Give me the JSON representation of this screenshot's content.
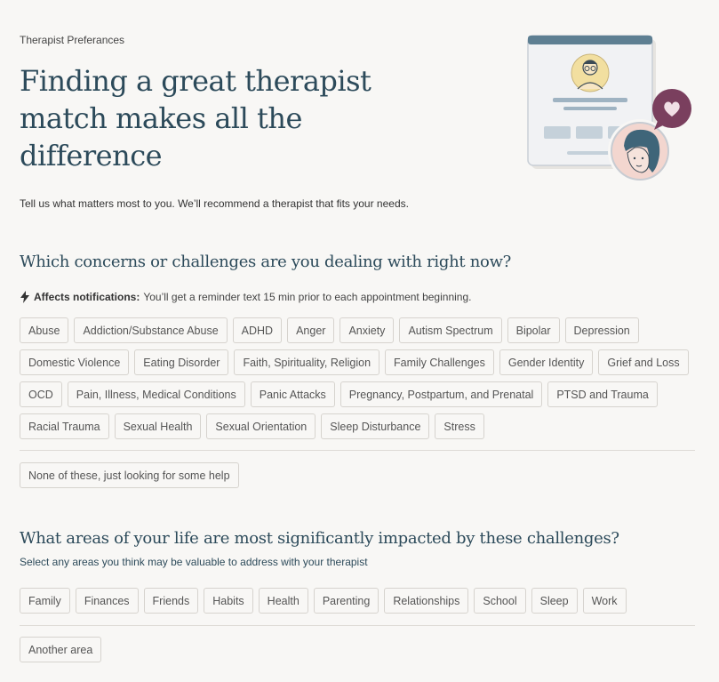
{
  "header": {
    "eyebrow": "Therapist Preferances",
    "title": "Finding a great therapist match makes all the difference",
    "intro": "Tell us what matters most to you. We’ll recommend a therapist that fits your needs."
  },
  "concerns": {
    "title": "Which concerns or challenges are you dealing with right now?",
    "note_label": "Affects notifications:",
    "note_text": "You’ll get a reminder text 15 min prior to each appointment beginning.",
    "options": [
      "Abuse",
      "Addiction/Substance Abuse",
      "ADHD",
      "Anger",
      "Anxiety",
      "Autism Spectrum",
      "Bipolar",
      "Depression",
      "Domestic Violence",
      "Eating Disorder",
      "Faith, Spirituality, Religion",
      "Family Challenges",
      "Gender Identity",
      "Grief and Loss",
      "OCD",
      "Pain, Illness, Medical Conditions",
      "Panic Attacks",
      "Pregnancy, Postpartum, and Prenatal",
      "PTSD and Trauma",
      "Racial Trauma",
      "Sexual Health",
      "Sexual Orientation",
      "Sleep Disturbance",
      "Stress"
    ],
    "none_option": "None of these, just looking for some help"
  },
  "areas": {
    "title": "What areas of your life are most significantly impacted by these challenges?",
    "subtitle": "Select any areas you think may be valuable to address with your therapist",
    "options": [
      "Family",
      "Finances",
      "Friends",
      "Habits",
      "Health",
      "Parenting",
      "Relationships",
      "School",
      "Sleep",
      "Work"
    ],
    "other_option": "Another area"
  },
  "colors": {
    "heading": "#2c4a5a",
    "chip_border": "#d6d3ce",
    "heart_bubble": "#7a3f5e"
  },
  "icons": [
    "lightning-bolt-icon",
    "heart-icon"
  ]
}
